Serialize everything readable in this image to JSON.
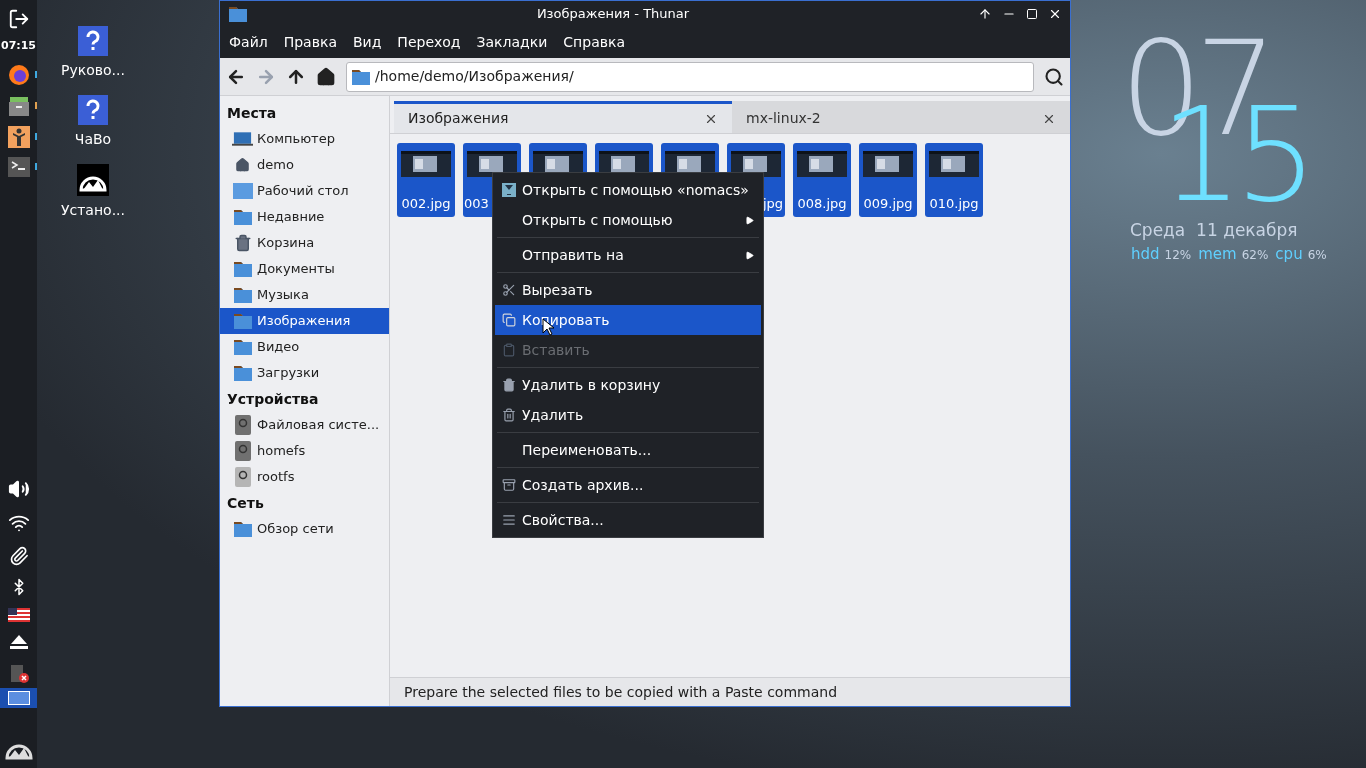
{
  "panel": {
    "clock": "07:15",
    "launchers": [
      {
        "color": "#3fa9e0"
      },
      {
        "color": "#e0a050"
      },
      {
        "color": "#3fa9e0"
      },
      {
        "color": "#3fa9e0"
      }
    ],
    "workspaces": [
      {
        "selected": true
      }
    ]
  },
  "desktop_icons": [
    {
      "label": "Руково..."
    },
    {
      "label": "ЧаВо"
    },
    {
      "label": "Устано..."
    }
  ],
  "clock_widget": {
    "hour": "07",
    "minute": "15",
    "date": "Среда  11 декабря",
    "stats": [
      {
        "name": "hdd",
        "value": "12%"
      },
      {
        "name": "mem",
        "value": "62%"
      },
      {
        "name": "cpu",
        "value": "6%"
      }
    ]
  },
  "window": {
    "title": "Изображения - Thunar",
    "menu": [
      "Файл",
      "Правка",
      "Вид",
      "Переход",
      "Закладки",
      "Справка"
    ],
    "toolbar": {
      "back_disabled": false,
      "forward_disabled": true,
      "path": "/home/demo/Изображения/"
    },
    "sidebar": [
      {
        "title": "Места",
        "items": [
          {
            "label": "Компьютер",
            "selected": false
          },
          {
            "label": "demo",
            "selected": false
          },
          {
            "label": "Рабочий стол",
            "selected": false
          },
          {
            "label": "Недавние",
            "selected": false
          },
          {
            "label": "Корзина",
            "selected": false
          },
          {
            "label": "Документы",
            "selected": false
          },
          {
            "label": "Музыка",
            "selected": false
          },
          {
            "label": "Изображения",
            "selected": true
          },
          {
            "label": "Видео",
            "selected": false
          },
          {
            "label": "Загрузки",
            "selected": false
          }
        ]
      },
      {
        "title": "Устройства",
        "items": [
          {
            "label": "Файловая систе...",
            "selected": false
          },
          {
            "label": "homefs",
            "selected": false
          },
          {
            "label": "rootfs",
            "selected": false
          }
        ]
      },
      {
        "title": "Сеть",
        "items": [
          {
            "label": "Обзор сети",
            "selected": false
          }
        ]
      }
    ],
    "tabs": [
      {
        "label": "Изображения",
        "selected": true
      },
      {
        "label": "mx-linux-2",
        "selected": false
      }
    ],
    "files": [
      {
        "label": "002.jpg",
        "selected": true
      },
      {
        "label": "003",
        "selected": true
      },
      {
        "selected": true
      },
      {
        "selected": true
      },
      {
        "selected": true
      },
      {
        "label": "jpg",
        "selected": true
      },
      {
        "label": "008.jpg",
        "selected": true
      },
      {
        "label": "009.jpg",
        "selected": true
      },
      {
        "label": "010.jpg",
        "selected": true
      }
    ],
    "status_bar": "Prepare the selected files to be copied with a Paste command"
  },
  "context_menu": [
    {
      "kind": "item",
      "label": "Открыть с помощью «nomacs»",
      "selected": false,
      "disabled": false,
      "submenu": false
    },
    {
      "kind": "item",
      "label": "Открыть с помощью",
      "selected": false,
      "disabled": false,
      "submenu": true
    },
    {
      "kind": "separator"
    },
    {
      "kind": "item",
      "label": "Отправить на",
      "selected": false,
      "disabled": false,
      "submenu": true
    },
    {
      "kind": "separator"
    },
    {
      "kind": "item",
      "label": "Вырезать",
      "selected": false,
      "disabled": false,
      "submenu": false
    },
    {
      "kind": "item",
      "label": "Копировать",
      "selected": true,
      "disabled": false,
      "submenu": false
    },
    {
      "kind": "item",
      "label": "Вставить",
      "selected": false,
      "disabled": true,
      "submenu": false
    },
    {
      "kind": "separator"
    },
    {
      "kind": "item",
      "label": "Удалить в корзину",
      "selected": false,
      "disabled": false,
      "submenu": false
    },
    {
      "kind": "item",
      "label": "Удалить",
      "selected": false,
      "disabled": false,
      "submenu": false
    },
    {
      "kind": "separator"
    },
    {
      "kind": "item",
      "label": "Переименовать...",
      "selected": false,
      "disabled": false,
      "submenu": false
    },
    {
      "kind": "separator"
    },
    {
      "kind": "item",
      "label": "Создать архив...",
      "selected": false,
      "disabled": false,
      "submenu": false
    },
    {
      "kind": "separator"
    },
    {
      "kind": "item",
      "label": "Свойства...",
      "selected": false,
      "disabled": false,
      "submenu": false
    }
  ]
}
